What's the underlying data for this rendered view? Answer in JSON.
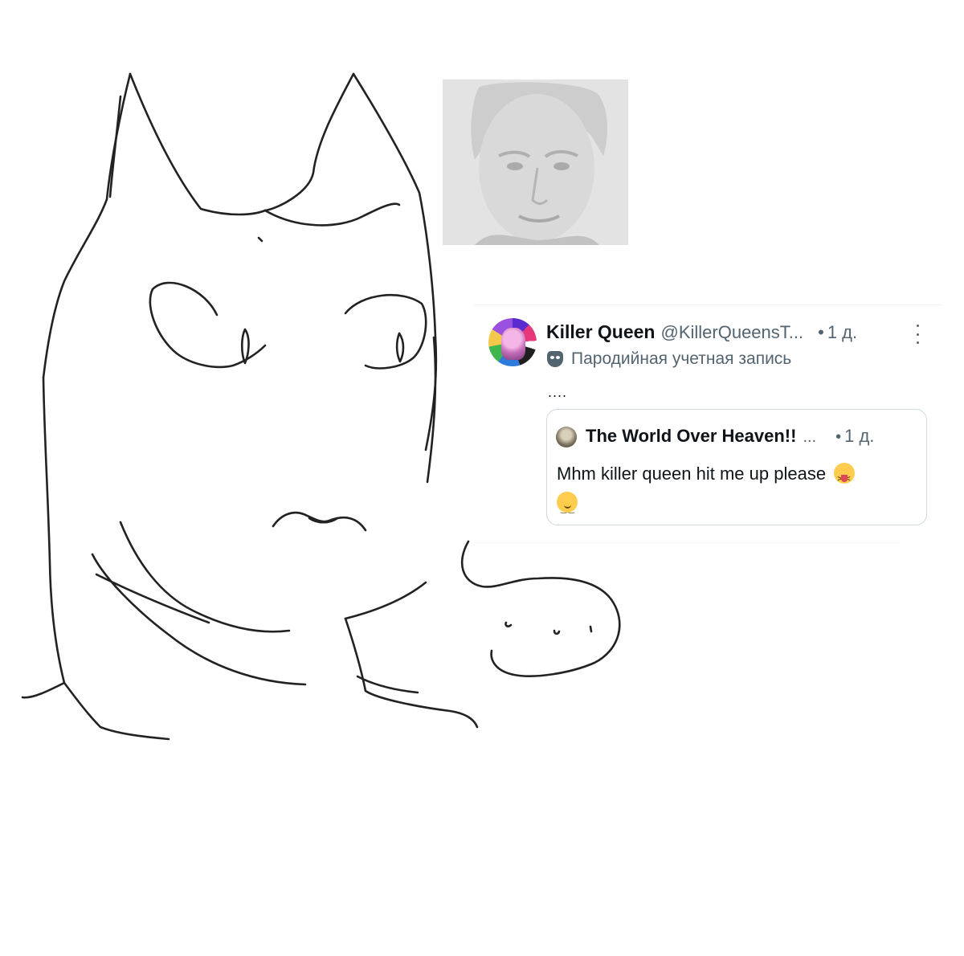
{
  "post": {
    "author_name": "Killer Queen",
    "author_handle": "@KillerQueensT...",
    "separator": "•",
    "time": "1 д.",
    "parody_label": "Пародийная учетная запись",
    "text": "....",
    "avatar_icon": "user-avatar",
    "more_icon": "more-vertical-icon",
    "parody_icon": "theater-mask-icon"
  },
  "quoted_post": {
    "author_name": "The World Over Heaven!!",
    "ellipsis": "...",
    "separator": "•",
    "time": "1 д.",
    "text": "Mhm killer queen hit me up please",
    "emojis": [
      "squinting-face-with-tongue",
      "smirking-face"
    ]
  },
  "colors": {
    "text_primary": "#0f1419",
    "text_secondary": "#536471",
    "border": "#cfd9de"
  }
}
